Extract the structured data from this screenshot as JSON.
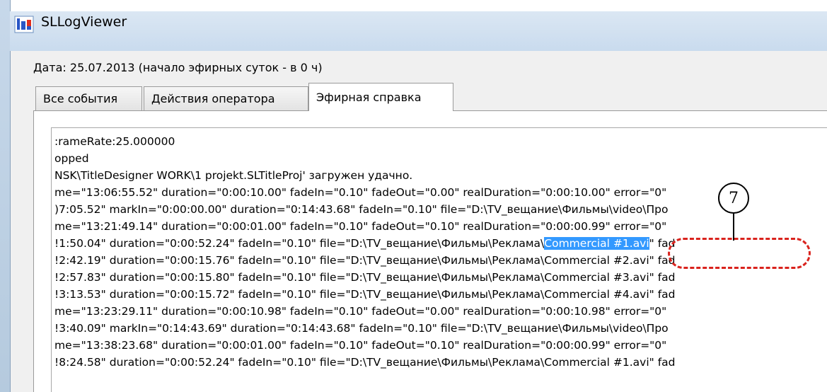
{
  "window": {
    "title": "SLLogViewer",
    "icon": "log-viewer-app-icon"
  },
  "header": {
    "date_label": "Дата: 25.07.2013 (начало эфирных суток - в 0 ч)"
  },
  "tabs": [
    {
      "label": "Все события",
      "active": false
    },
    {
      "label": "Действия оператора",
      "active": false
    },
    {
      "label": "Эфирная справка",
      "active": true
    }
  ],
  "log_lines": [
    ":rameRate:25.000000",
    "opped",
    "NSK\\TitleDesigner WORK\\1 projekt.SLTitleProj' загружен удачно.",
    "me=\"13:06:55.52\" duration=\"0:00:10.00\" fadeIn=\"0.10\" fadeOut=\"0.00\" realDuration=\"0:00:10.00\" error=\"0\"",
    ")7:05.52\" markIn=\"0:00:00.00\" duration=\"0:14:43.68\" fadeIn=\"0.10\" file=\"D:\\TV_вещание\\Фильмы\\video\\Про",
    "me=\"13:21:49.14\" duration=\"0:00:01.00\" fadeIn=\"0.10\" fadeOut=\"0.10\" realDuration=\"0:00:00.99\" error=\"0\"",
    "!1:50.04\" duration=\"0:00:52.24\" fadeIn=\"0.10\" file=\"D:\\TV_вещание\\Фильмы\\Реклама\\",
    "!2:42.19\" duration=\"0:00:15.76\" fadeIn=\"0.10\" file=\"D:\\TV_вещание\\Фильмы\\Реклама\\Commercial #2.avi\" fad",
    "!2:57.83\" duration=\"0:00:15.80\" fadeIn=\"0.10\" file=\"D:\\TV_вещание\\Фильмы\\Реклама\\Commercial #3.avi\" fad",
    "!3:13.53\" duration=\"0:00:15.72\" fadeIn=\"0.10\" file=\"D:\\TV_вещание\\Фильмы\\Реклама\\Commercial #4.avi\" fad",
    "me=\"13:23:29.11\" duration=\"0:00:10.98\" fadeIn=\"0.10\" fadeOut=\"0.00\" realDuration=\"0:00:10.98\" error=\"0\"",
    "!3:40.09\" markIn=\"0:14:43.69\" duration=\"0:14:43.68\" fadeIn=\"0.10\" file=\"D:\\TV_вещание\\Фильмы\\video\\Про",
    "me=\"13:38:23.68\" duration=\"0:00:01.00\" fadeIn=\"0.10\" fadeOut=\"0.10\" realDuration=\"0:00:00.99\" error=\"0\"",
    "!8:24.58\" duration=\"0:00:52.24\" fadeIn=\"0.10\" file=\"D:\\TV_вещание\\Фильмы\\Реклама\\Commercial #1.avi\" fad"
  ],
  "selection": {
    "text": "Commercial #1.avi",
    "after": "\" fad"
  },
  "callout": {
    "number": "7"
  },
  "colors": {
    "selection": "#3399ff",
    "callout_outline": "#d9231d"
  }
}
